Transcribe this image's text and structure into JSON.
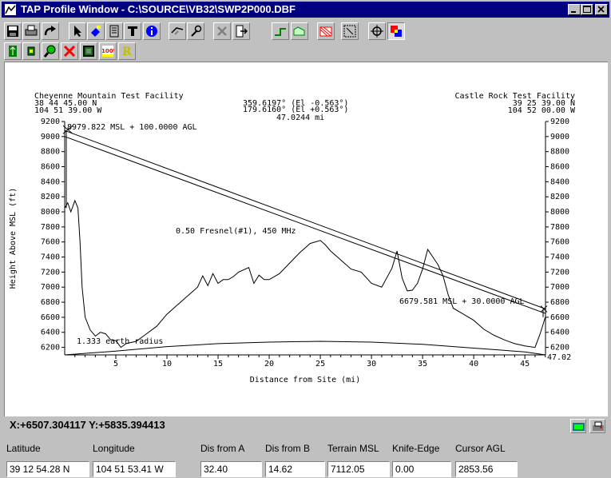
{
  "window": {
    "title": "TAP Profile Window - C:\\SOURCE\\VB32\\SWP2P000.DBF"
  },
  "toolbar1": [
    "save-icon",
    "print-icon",
    "redo-icon",
    "pointer-icon",
    "fill-icon",
    "document-icon",
    "text-tool-icon",
    "info-icon",
    "measure-icon",
    "tool-icon",
    "delete-icon",
    "exit-icon",
    "green-profile-icon",
    "area-icon",
    "hatch-icon",
    "zoom-box-icon",
    "crosshair-icon",
    "color-palette-icon"
  ],
  "toolbar2": [
    "green-site-icon",
    "small-site-icon",
    "magnify-icon",
    "red-x-icon",
    "map-icon",
    "zoom-100-icon",
    "yellow-r-icon"
  ],
  "plot": {
    "site_a": {
      "name": "Cheyenne Mountain Test Facility",
      "lat": "38 44 45.00 N",
      "lon": "104 51 39.00 W"
    },
    "site_b": {
      "name": "Castle Rock Test Facility",
      "lat": "39 25 39.00 N",
      "lon": "104 52 00.00 W"
    },
    "bearing_line1": "359.6197° (El -0.563°)",
    "bearing_line2": "179.6160° (El +0.563°)",
    "path_distance": "47.0244 mi",
    "ant_a_label": "8979.822 MSL + 100.0000 AGL",
    "ant_b_label": "6679.581 MSL + 30.0000 AGL",
    "fresnel_label": "0.50 Fresnel(#1), 450 MHz",
    "earth_label": "1.333 earth radius",
    "x_end_label": "47.02",
    "ylabel": "Height Above MSL (ft)",
    "xlabel": "Distance from Site (mi)",
    "y_ticks": [
      "6200",
      "6400",
      "6600",
      "6800",
      "7000",
      "7200",
      "7400",
      "7600",
      "7800",
      "8000",
      "8200",
      "8400",
      "8600",
      "8800",
      "9000",
      "9200"
    ],
    "x_ticks": [
      "5",
      "10",
      "15",
      "20",
      "25",
      "30",
      "35",
      "40",
      "45"
    ]
  },
  "chart_data": {
    "type": "line",
    "xlabel": "Distance from Site (mi)",
    "ylabel": "Height Above MSL (ft)",
    "xlim": [
      0,
      47.02
    ],
    "ylim": [
      6100,
      9200
    ],
    "series": [
      {
        "name": "terrain",
        "x": [
          0,
          0.3,
          0.6,
          1.0,
          1.3,
          1.5,
          1.7,
          2.0,
          2.5,
          3.0,
          3.5,
          4.0,
          4.5,
          5.0,
          5.5,
          6.0,
          7.0,
          8.0,
          9.0,
          10.0,
          11.0,
          12.0,
          13.0,
          13.5,
          14.0,
          14.5,
          15.0,
          15.5,
          16.0,
          16.5,
          17.0,
          18.0,
          18.5,
          19.0,
          19.5,
          20.0,
          21.0,
          22.0,
          23.0,
          24.0,
          25.0,
          25.5,
          26.0,
          27.0,
          28.0,
          29.0,
          30.0,
          31.0,
          32.0,
          32.5,
          33.0,
          33.5,
          34.0,
          34.5,
          35.0,
          35.5,
          36.0,
          36.5,
          37.0,
          37.5,
          38.0,
          39.0,
          40.0,
          41.0,
          42.0,
          43.0,
          44.0,
          45.0,
          46.0,
          46.5,
          47.0
        ],
        "y": [
          8050,
          8120,
          8000,
          8150,
          8050,
          7600,
          7000,
          6600,
          6430,
          6350,
          6400,
          6380,
          6300,
          6290,
          6200,
          6250,
          6280,
          6380,
          6480,
          6640,
          6760,
          6880,
          7000,
          7150,
          7020,
          7180,
          7050,
          7100,
          7100,
          7140,
          7200,
          7260,
          7050,
          7160,
          7100,
          7100,
          7180,
          7320,
          7460,
          7580,
          7620,
          7560,
          7480,
          7360,
          7240,
          7200,
          7050,
          7000,
          7250,
          7480,
          7120,
          6950,
          6960,
          7050,
          7240,
          7500,
          7400,
          7300,
          7150,
          6900,
          6720,
          6640,
          6560,
          6440,
          6360,
          6300,
          6250,
          6220,
          6200,
          6380,
          6600
        ]
      },
      {
        "name": "direct path",
        "x": [
          0,
          47.02
        ],
        "y": [
          9080,
          6710
        ]
      },
      {
        "name": "fresnel",
        "x": [
          0,
          47.02
        ],
        "y": [
          9000,
          6650
        ]
      },
      {
        "name": "earth curvature",
        "x": [
          0,
          5,
          10,
          15,
          20,
          25,
          30,
          35,
          40,
          45,
          47.02
        ],
        "y": [
          6100,
          6150,
          6210,
          6250,
          6270,
          6280,
          6270,
          6240,
          6190,
          6140,
          6100
        ]
      }
    ]
  },
  "status": {
    "coords": "X:+6507.304117 Y:+5835.394413",
    "fields": [
      {
        "label": "Latitude",
        "value": "39 12 54.28 N"
      },
      {
        "label": "Longitude",
        "value": "104 51 53.41 W"
      },
      {
        "label": "Dis from A",
        "value": "32.40"
      },
      {
        "label": "Dis from B",
        "value": "14.62"
      },
      {
        "label": "Terrain MSL",
        "value": "7112.05"
      },
      {
        "label": "Knife-Edge",
        "value": "0.00"
      },
      {
        "label": "Cursor AGL",
        "value": "2853.56"
      }
    ]
  },
  "colors": {
    "titlebar": "#000080",
    "face": "#c0c0c0",
    "plot_bg": "#ffffff"
  }
}
